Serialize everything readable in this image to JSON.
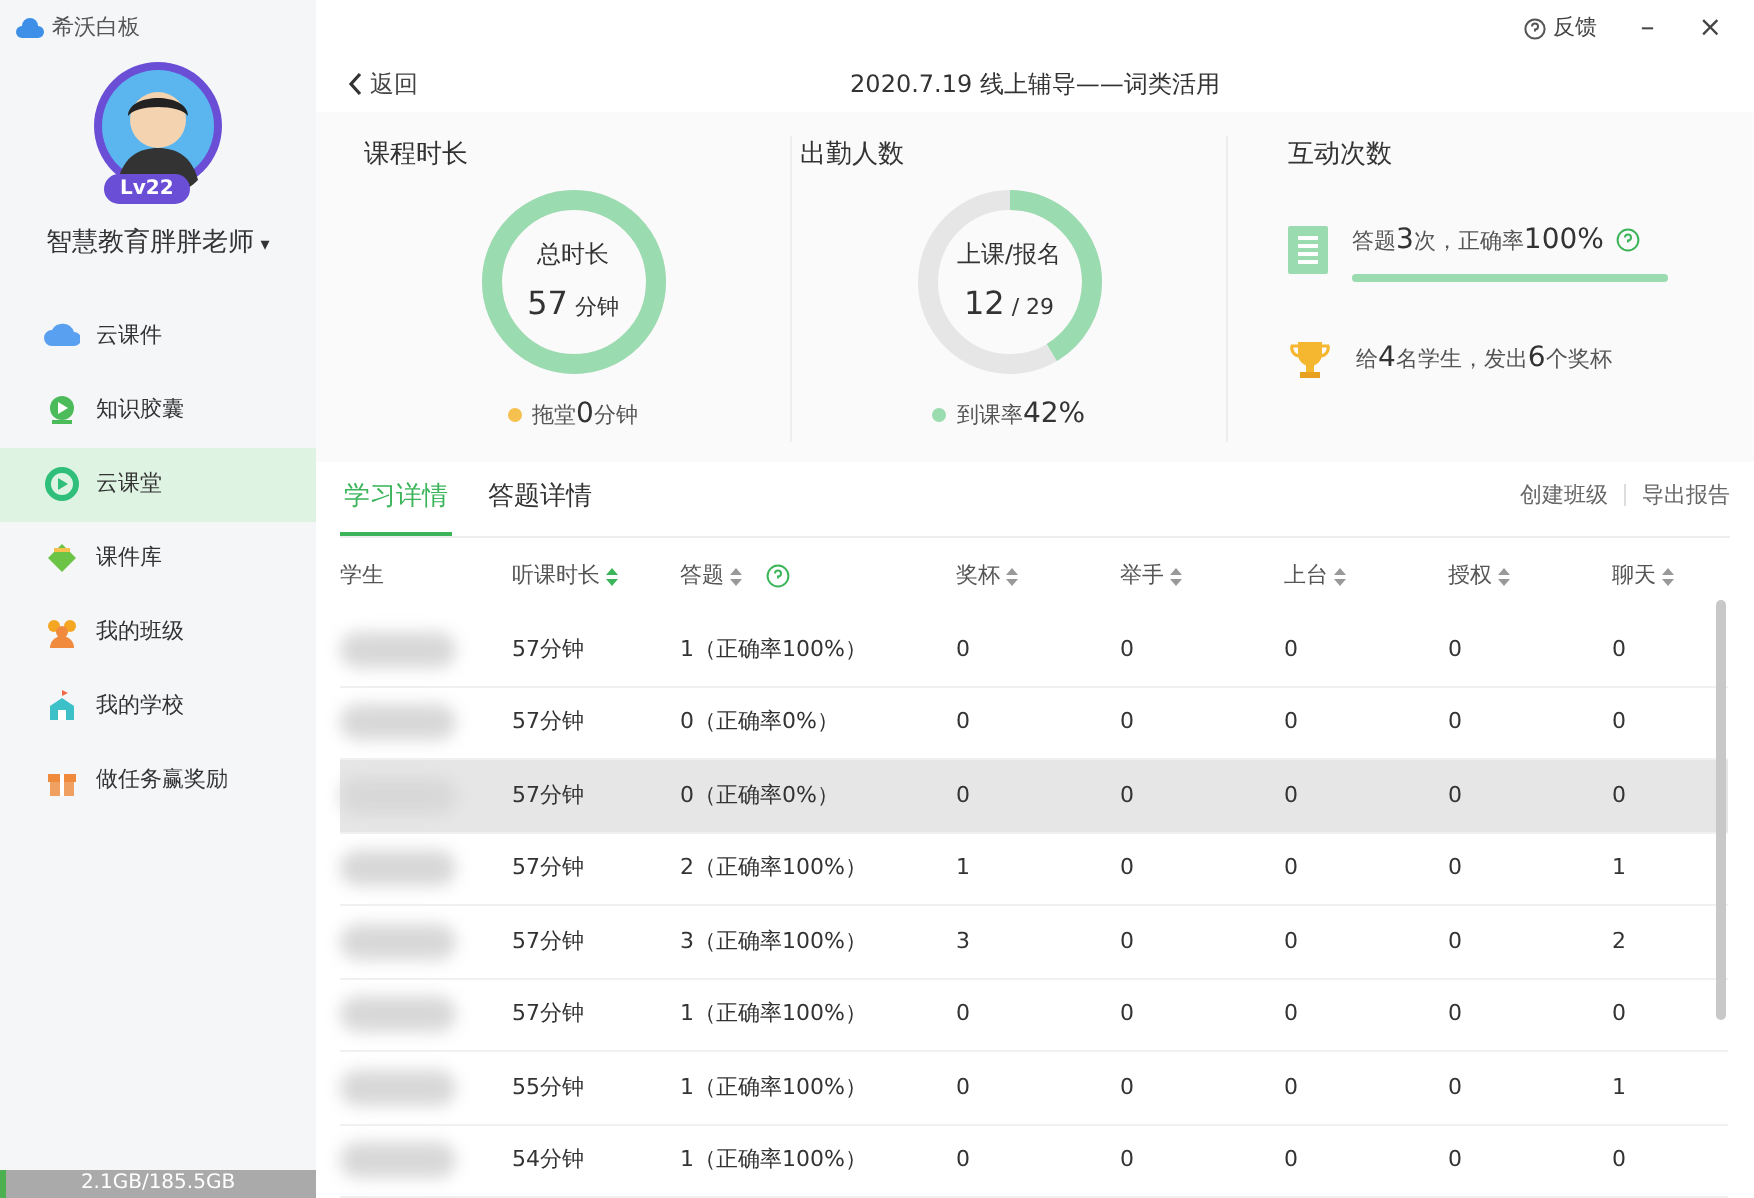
{
  "app": {
    "title": "希沃白板"
  },
  "user": {
    "name": "智慧教育胖胖老师",
    "caret": "▾",
    "level": "Lv22"
  },
  "nav": [
    {
      "label": "云课件",
      "selected": false
    },
    {
      "label": "知识胶囊",
      "selected": false
    },
    {
      "label": "云课堂",
      "selected": true
    },
    {
      "label": "课件库",
      "selected": false
    },
    {
      "label": "我的班级",
      "selected": false
    },
    {
      "label": "我的学校",
      "selected": false
    },
    {
      "label": "做任务赢奖励",
      "selected": false
    }
  ],
  "storage": {
    "text": "2.1GB/185.5GB",
    "level": 0.02
  },
  "window": {
    "feedback": "反馈",
    "minimize": "–",
    "close": "×"
  },
  "header": {
    "back": "返回",
    "title": "2020.7.19 线上辅导——词类活用"
  },
  "stats": [
    {
      "kind": "donut",
      "title": "课程时长",
      "center_label": "总时长",
      "value": "57",
      "unit": "分钟",
      "level": 1,
      "note": {
        "text": "拖堂**0**分钟",
        "color": "#f5c04e"
      }
    },
    {
      "kind": "donut",
      "title": "出勤人数",
      "center_label": "上课/报名",
      "value": "12",
      "unit": "/ 29",
      "level": 0.414,
      "note": {
        "text": "到课率**42%**",
        "color": "#9bdbb0"
      }
    },
    {
      "kind": "interaction",
      "title": "互动次数",
      "answer": {
        "text": "答题**3**次，正确率**100%**",
        "level": 1
      },
      "award": "给**4**名学生，发出**6**个奖杯"
    }
  ],
  "tabs": [
    {
      "label": "学习详情",
      "selected": true
    },
    {
      "label": "答题详情",
      "selected": false
    }
  ],
  "actions": [
    "创建班级",
    "导出报告"
  ],
  "table": {
    "columns": [
      {
        "label": "学生",
        "sortable": false,
        "sorted": false
      },
      {
        "label": "听课时长",
        "sortable": true,
        "sorted": true
      },
      {
        "label": "答题",
        "sortable": true,
        "sorted": false,
        "help": true
      },
      {
        "label": "奖杯",
        "sortable": true,
        "sorted": false
      },
      {
        "label": "举手",
        "sortable": true,
        "sorted": false
      },
      {
        "label": "上台",
        "sortable": true,
        "sorted": false
      },
      {
        "label": "授权",
        "sortable": true,
        "sorted": false
      },
      {
        "label": "聊天",
        "sortable": true,
        "sorted": false
      }
    ],
    "rows": [
      {
        "selected": false,
        "cells": [
          "",
          "57分钟",
          "1（正确率100%）",
          "0",
          "0",
          "0",
          "0",
          "0"
        ]
      },
      {
        "selected": false,
        "cells": [
          "",
          "57分钟",
          "0（正确率0%）",
          "0",
          "0",
          "0",
          "0",
          "0"
        ]
      },
      {
        "selected": true,
        "cells": [
          "",
          "57分钟",
          "0（正确率0%）",
          "0",
          "0",
          "0",
          "0",
          "0"
        ]
      },
      {
        "selected": false,
        "cells": [
          "",
          "57分钟",
          "2（正确率100%）",
          "1",
          "0",
          "0",
          "0",
          "1"
        ]
      },
      {
        "selected": false,
        "cells": [
          "",
          "57分钟",
          "3（正确率100%）",
          "3",
          "0",
          "0",
          "0",
          "2"
        ]
      },
      {
        "selected": false,
        "cells": [
          "",
          "57分钟",
          "1（正确率100%）",
          "0",
          "0",
          "0",
          "0",
          "0"
        ]
      },
      {
        "selected": false,
        "cells": [
          "",
          "55分钟",
          "1（正确率100%）",
          "0",
          "0",
          "0",
          "0",
          "1"
        ]
      },
      {
        "selected": false,
        "cells": [
          "",
          "54分钟",
          "1（正确率100%）",
          "0",
          "0",
          "0",
          "0",
          "0"
        ]
      }
    ]
  }
}
